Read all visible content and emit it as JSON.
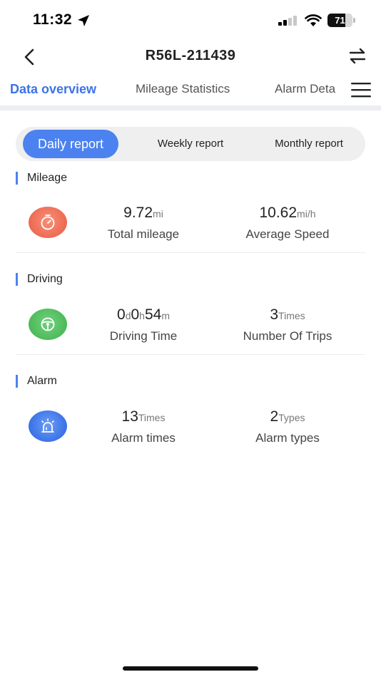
{
  "status_bar": {
    "time": "11:32",
    "battery_level": "71",
    "battery_fraction": 0.71
  },
  "nav": {
    "title": "R56L-211439",
    "back_icon": "chevron-left-icon",
    "switch_icon": "swap-arrows-icon"
  },
  "tabs": [
    {
      "label": "Data overview",
      "active": true
    },
    {
      "label": "Mileage Statistics",
      "active": false
    },
    {
      "label": "Alarm Deta",
      "active": false
    }
  ],
  "report_segments": [
    {
      "label": "Daily report",
      "active": true
    },
    {
      "label": "Weekly report",
      "active": false
    },
    {
      "label": "Monthly report",
      "active": false
    }
  ],
  "sections": {
    "mileage": {
      "title": "Mileage",
      "icon": "gauge-icon",
      "color": "#f0735a",
      "stats": [
        {
          "value": "9.72",
          "unit": "mi",
          "label": "Total mileage"
        },
        {
          "value": "10.62",
          "unit": "mi/h",
          "label": "Average Speed"
        }
      ]
    },
    "driving": {
      "title": "Driving",
      "icon": "steering-wheel-icon",
      "color": "#4cbb5a",
      "driving_time": {
        "d": "0",
        "d_unit": "d",
        "h": "0",
        "h_unit": "h",
        "m": "54",
        "m_unit": "m"
      },
      "driving_time_label": "Driving Time",
      "trips": {
        "value": "3",
        "unit": "Times",
        "label": "Number Of Trips"
      }
    },
    "alarm": {
      "title": "Alarm",
      "icon": "siren-icon",
      "color": "#3b73e6",
      "stats": [
        {
          "value": "13",
          "unit": "Times",
          "label": "Alarm times"
        },
        {
          "value": "2",
          "unit": "Types",
          "label": "Alarm types"
        }
      ]
    }
  },
  "colors": {
    "accent": "#3b73e6",
    "segment_active": "#4b82f0"
  }
}
